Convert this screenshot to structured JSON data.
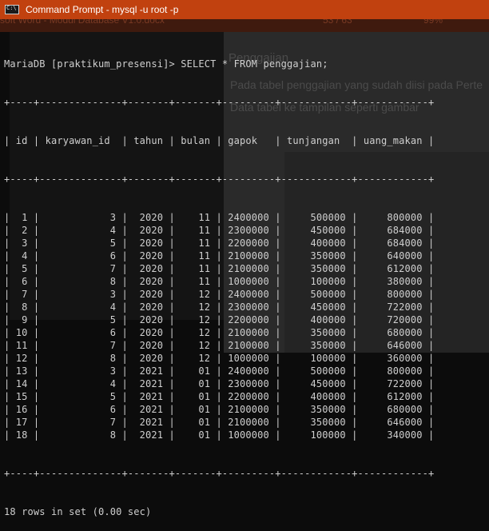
{
  "window": {
    "title": "Command Prompt - mysql  -u root -p",
    "icon": "cmd-icon"
  },
  "background_app": {
    "doc_title": "soft Word - Modul Database V1.0.docx",
    "page_counter": "53 / 63",
    "zoom": "99%",
    "heading": "Penggajian",
    "paragraph_1": "Pada tabel penggajian yang sudah diisi pada Perte",
    "paragraph_2": "Data tabel ke tampilan seperti gambar"
  },
  "console": {
    "prompt": "MariaDB [praktikum_presensi]> SELECT * FROM penggajian;",
    "border": "+----+--------------+-------+-------+---------+------------+------------+",
    "header": "| id | karyawan_id  | tahun | bulan | gapok   | tunjangan  | uang_makan |",
    "columns": [
      "id",
      "karyawan_id",
      "tahun",
      "bulan",
      "gapok",
      "tunjangan",
      "uang_makan"
    ],
    "rows": [
      [
        "1",
        "3",
        "2020",
        "11",
        "2400000",
        "500000",
        "800000"
      ],
      [
        "2",
        "4",
        "2020",
        "11",
        "2300000",
        "450000",
        "684000"
      ],
      [
        "3",
        "5",
        "2020",
        "11",
        "2200000",
        "400000",
        "684000"
      ],
      [
        "4",
        "6",
        "2020",
        "11",
        "2100000",
        "350000",
        "640000"
      ],
      [
        "5",
        "7",
        "2020",
        "11",
        "2100000",
        "350000",
        "612000"
      ],
      [
        "6",
        "8",
        "2020",
        "11",
        "1000000",
        "100000",
        "380000"
      ],
      [
        "7",
        "3",
        "2020",
        "12",
        "2400000",
        "500000",
        "800000"
      ],
      [
        "8",
        "4",
        "2020",
        "12",
        "2300000",
        "450000",
        "722000"
      ],
      [
        "9",
        "5",
        "2020",
        "12",
        "2200000",
        "400000",
        "720000"
      ],
      [
        "10",
        "6",
        "2020",
        "12",
        "2100000",
        "350000",
        "680000"
      ],
      [
        "11",
        "7",
        "2020",
        "12",
        "2100000",
        "350000",
        "646000"
      ],
      [
        "12",
        "8",
        "2020",
        "12",
        "1000000",
        "100000",
        "360000"
      ],
      [
        "13",
        "3",
        "2021",
        "01",
        "2400000",
        "500000",
        "800000"
      ],
      [
        "14",
        "4",
        "2021",
        "01",
        "2300000",
        "450000",
        "722000"
      ],
      [
        "15",
        "5",
        "2021",
        "01",
        "2200000",
        "400000",
        "612000"
      ],
      [
        "16",
        "6",
        "2021",
        "01",
        "2100000",
        "350000",
        "680000"
      ],
      [
        "17",
        "7",
        "2021",
        "01",
        "2100000",
        "350000",
        "646000"
      ],
      [
        "18",
        "8",
        "2021",
        "01",
        "1000000",
        "100000",
        "340000"
      ]
    ],
    "footer": "18 rows in set (0.00 sec)"
  }
}
